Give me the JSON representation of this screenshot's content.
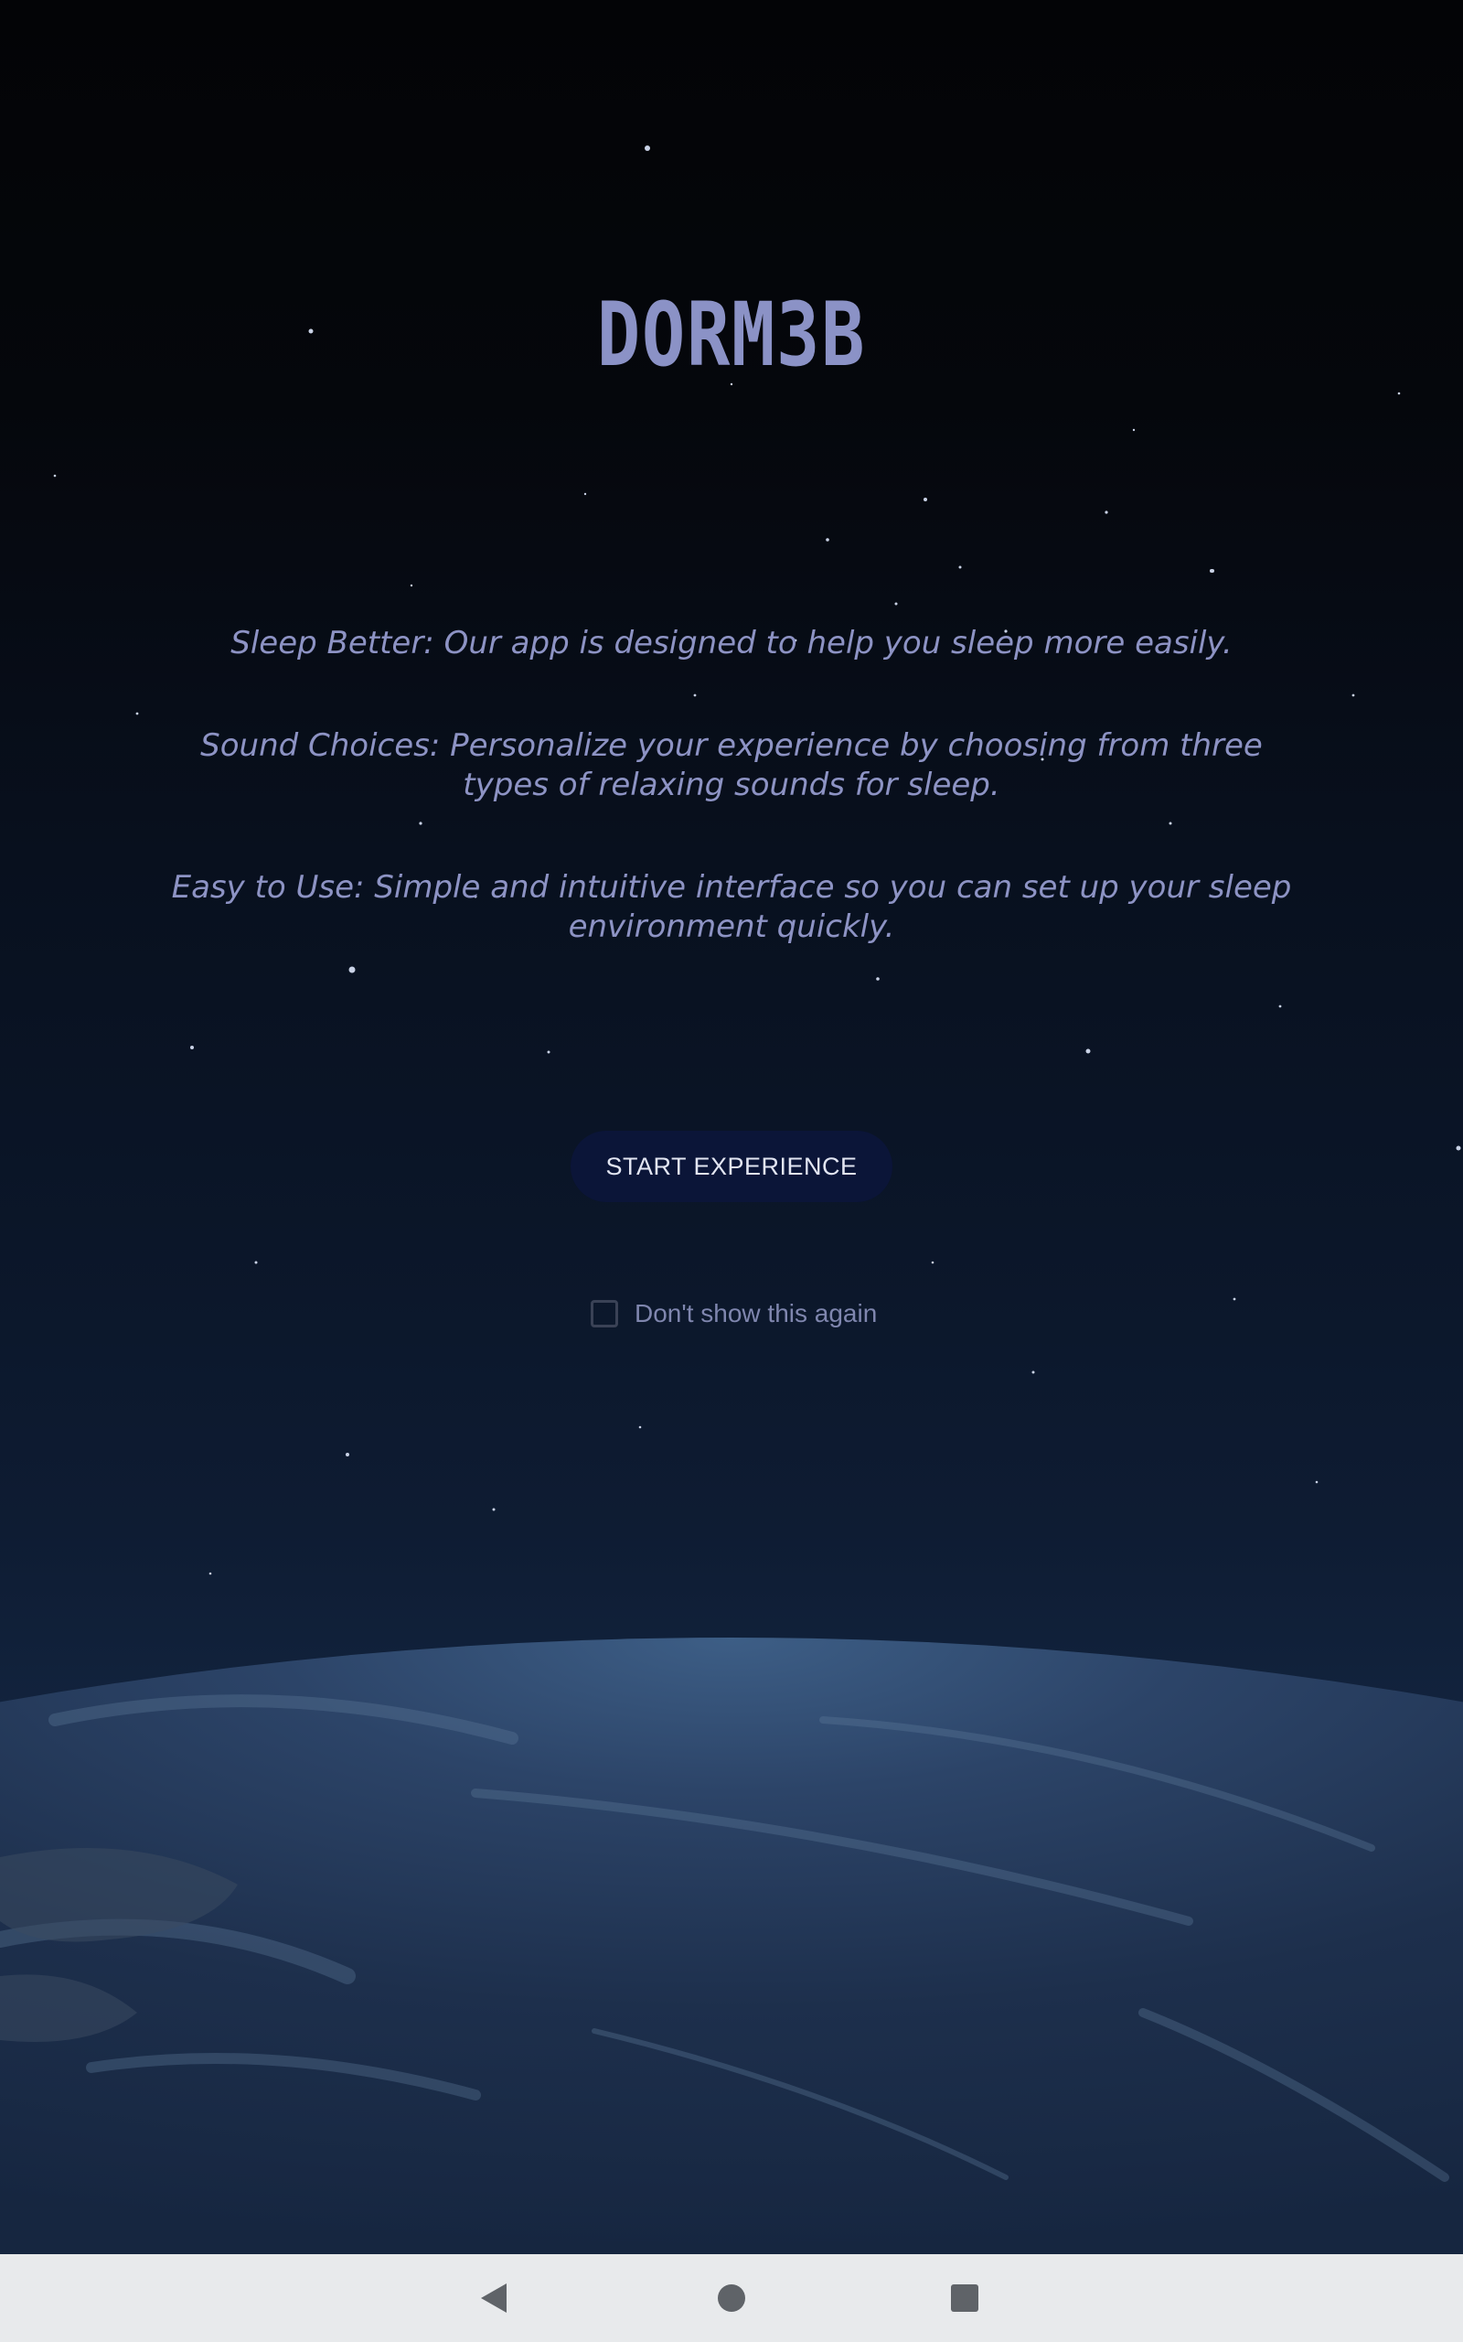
{
  "app": {
    "logo_text": "DORM3B"
  },
  "features": [
    {
      "text": "Sleep Better: Our app is designed to help you sleep more easily."
    },
    {
      "text": "Sound Choices: Personalize your experience by choosing from three types of relaxing sounds for sleep."
    },
    {
      "text": "Easy to Use: Simple and intuitive interface so you can set up your sleep environment quickly."
    }
  ],
  "start_button": {
    "label": "START EXPERIENCE",
    "background": "#0b1538"
  },
  "dont_show": {
    "label": "Don't show this again",
    "checked": false
  },
  "navigation_bar": {
    "buttons": [
      {
        "icon": "back-triangle-icon"
      },
      {
        "icon": "home-circle-icon"
      },
      {
        "icon": "recents-square-icon"
      }
    ]
  },
  "colors": {
    "text_accent": "#8d93c4",
    "nav_background": "#e8eaec",
    "nav_icon": "#5f6368"
  }
}
